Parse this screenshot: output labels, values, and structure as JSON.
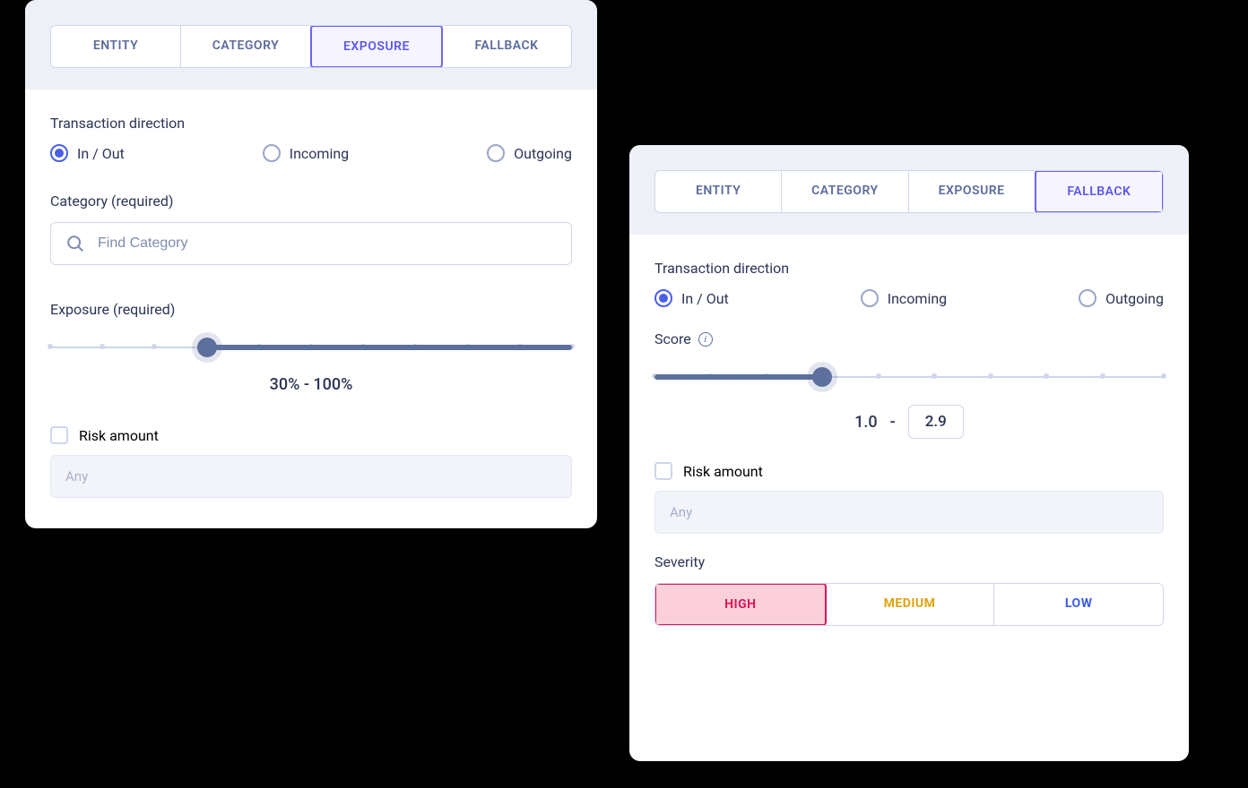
{
  "left": {
    "tabs": [
      "ENTITY",
      "CATEGORY",
      "EXPOSURE",
      "FALLBACK"
    ],
    "activeTab": 2,
    "direction": {
      "label": "Transaction direction",
      "options": [
        "In / Out",
        "Incoming",
        "Outgoing"
      ],
      "selected": 0
    },
    "category": {
      "label": "Category (required)",
      "placeholder": "Find Category"
    },
    "exposure": {
      "label": "Exposure (required)",
      "min": 30,
      "max": 100,
      "display": "30%  -  100%"
    },
    "riskAmount": {
      "label": "Risk amount",
      "placeholder": "Any"
    }
  },
  "right": {
    "tabs": [
      "ENTITY",
      "CATEGORY",
      "EXPOSURE",
      "FALLBACK"
    ],
    "activeTab": 3,
    "direction": {
      "label": "Transaction direction",
      "options": [
        "In / Out",
        "Incoming",
        "Outgoing"
      ],
      "selected": 0
    },
    "score": {
      "label": "Score",
      "min": "1.0",
      "max": "2.9",
      "dash": "-"
    },
    "riskAmount": {
      "label": "Risk amount",
      "placeholder": "Any"
    },
    "severity": {
      "label": "Severity",
      "options": [
        "HIGH",
        "MEDIUM",
        "LOW"
      ],
      "selected": 0
    }
  }
}
